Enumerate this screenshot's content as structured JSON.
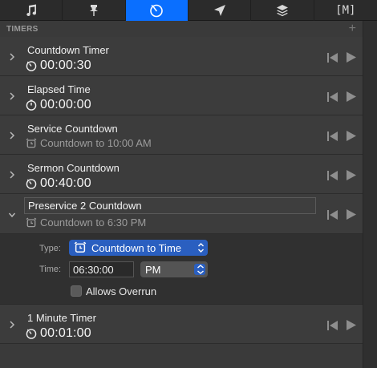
{
  "tabs": [
    {
      "name": "tab-music",
      "icon": "music-note-icon",
      "active": false
    },
    {
      "name": "tab-props",
      "icon": "pin-icon",
      "active": false
    },
    {
      "name": "tab-timers",
      "icon": "timer-icon",
      "active": true
    },
    {
      "name": "tab-messages",
      "icon": "send-arrow-icon",
      "active": false
    },
    {
      "name": "tab-layers",
      "icon": "layers-icon",
      "active": false
    },
    {
      "name": "tab-macros",
      "icon": "macro-bracket-icon",
      "label": "[M]",
      "active": false
    }
  ],
  "section": {
    "title": "TIMERS",
    "add_label": "+"
  },
  "timers": [
    {
      "title": "Countdown Timer",
      "value": "00:00:30",
      "kind": "countdown"
    },
    {
      "title": "Elapsed Time",
      "value": "00:00:00",
      "kind": "elapsed"
    },
    {
      "title": "Service Countdown",
      "value": "Countdown to 10:00 AM",
      "kind": "clock"
    },
    {
      "title": "Sermon Countdown",
      "value": "00:40:00",
      "kind": "countdown"
    },
    {
      "title": "Preservice 2 Countdown",
      "value": "Countdown to 6:30 PM",
      "kind": "clock",
      "selected": true
    },
    {
      "title": "1 Minute Timer",
      "value": "00:01:00",
      "kind": "countdown"
    }
  ],
  "details": {
    "type_label": "Type:",
    "type_value": "Countdown to Time",
    "time_label": "Time:",
    "time_value": "06:30:00",
    "ampm_value": "PM",
    "overrun_label": "Allows Overrun",
    "overrun_checked": false
  },
  "colors": {
    "accent": "#0a6fff",
    "popup_blue": "#2a5fc0"
  }
}
